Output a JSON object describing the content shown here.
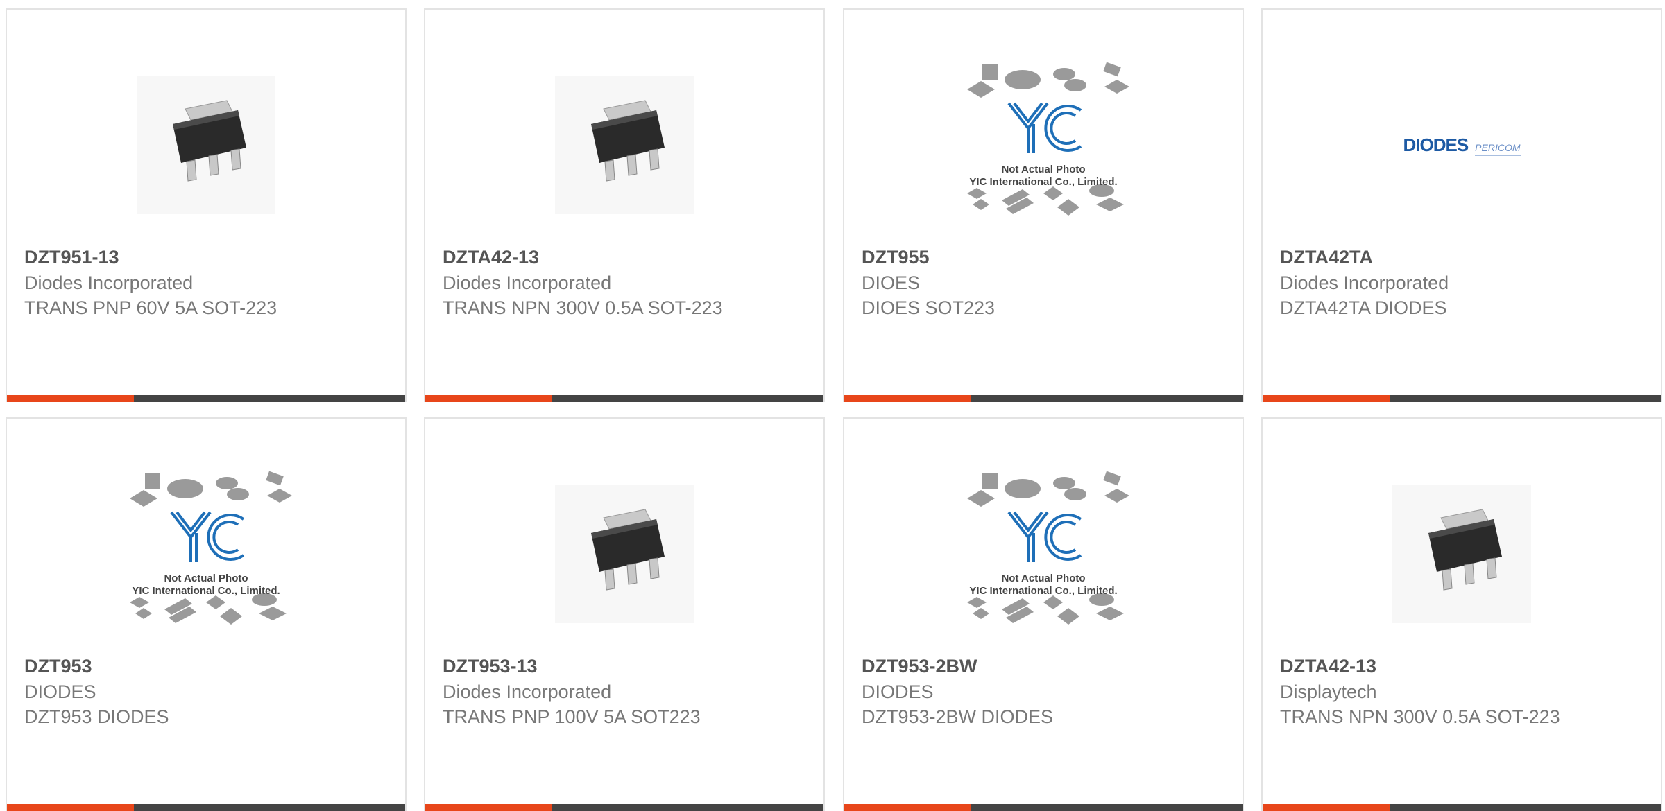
{
  "colors": {
    "accent": "#e8461a",
    "bar": "#444444"
  },
  "cards": [
    {
      "part": "DZT951-13",
      "manufacturer": "Diodes Incorporated",
      "description": "TRANS PNP 60V 5A SOT-223",
      "image": "sot223-package"
    },
    {
      "part": "DZTA42-13",
      "manufacturer": "Diodes Incorporated",
      "description": "TRANS NPN 300V 0.5A SOT-223",
      "image": "sot223-package"
    },
    {
      "part": "DZT955",
      "manufacturer": "DIOES",
      "description": "DIOES SOT223",
      "image": "yic-placeholder"
    },
    {
      "part": "DZTA42TA",
      "manufacturer": "Diodes Incorporated",
      "description": "DZTA42TA DIODES",
      "image": "diodes-logo"
    },
    {
      "part": "DZT953",
      "manufacturer": "DIODES",
      "description": "DZT953 DIODES",
      "image": "yic-placeholder"
    },
    {
      "part": "DZT953-13",
      "manufacturer": "Diodes Incorporated",
      "description": "TRANS PNP 100V 5A SOT223",
      "image": "sot223-package"
    },
    {
      "part": "DZT953-2BW",
      "manufacturer": "DIODES",
      "description": "DZT953-2BW DIODES",
      "image": "yic-placeholder"
    },
    {
      "part": "DZTA42-13",
      "manufacturer": "Displaytech",
      "description": "TRANS NPN 300V 0.5A SOT-223",
      "image": "sot223-package"
    }
  ],
  "placeholder": {
    "line1": "Not Actual Photo",
    "line2": "YIC International Co., Limited.",
    "logo_text": "YIC"
  },
  "diodes_logo": {
    "brand": "DIODES",
    "partner": "PERICOM"
  }
}
